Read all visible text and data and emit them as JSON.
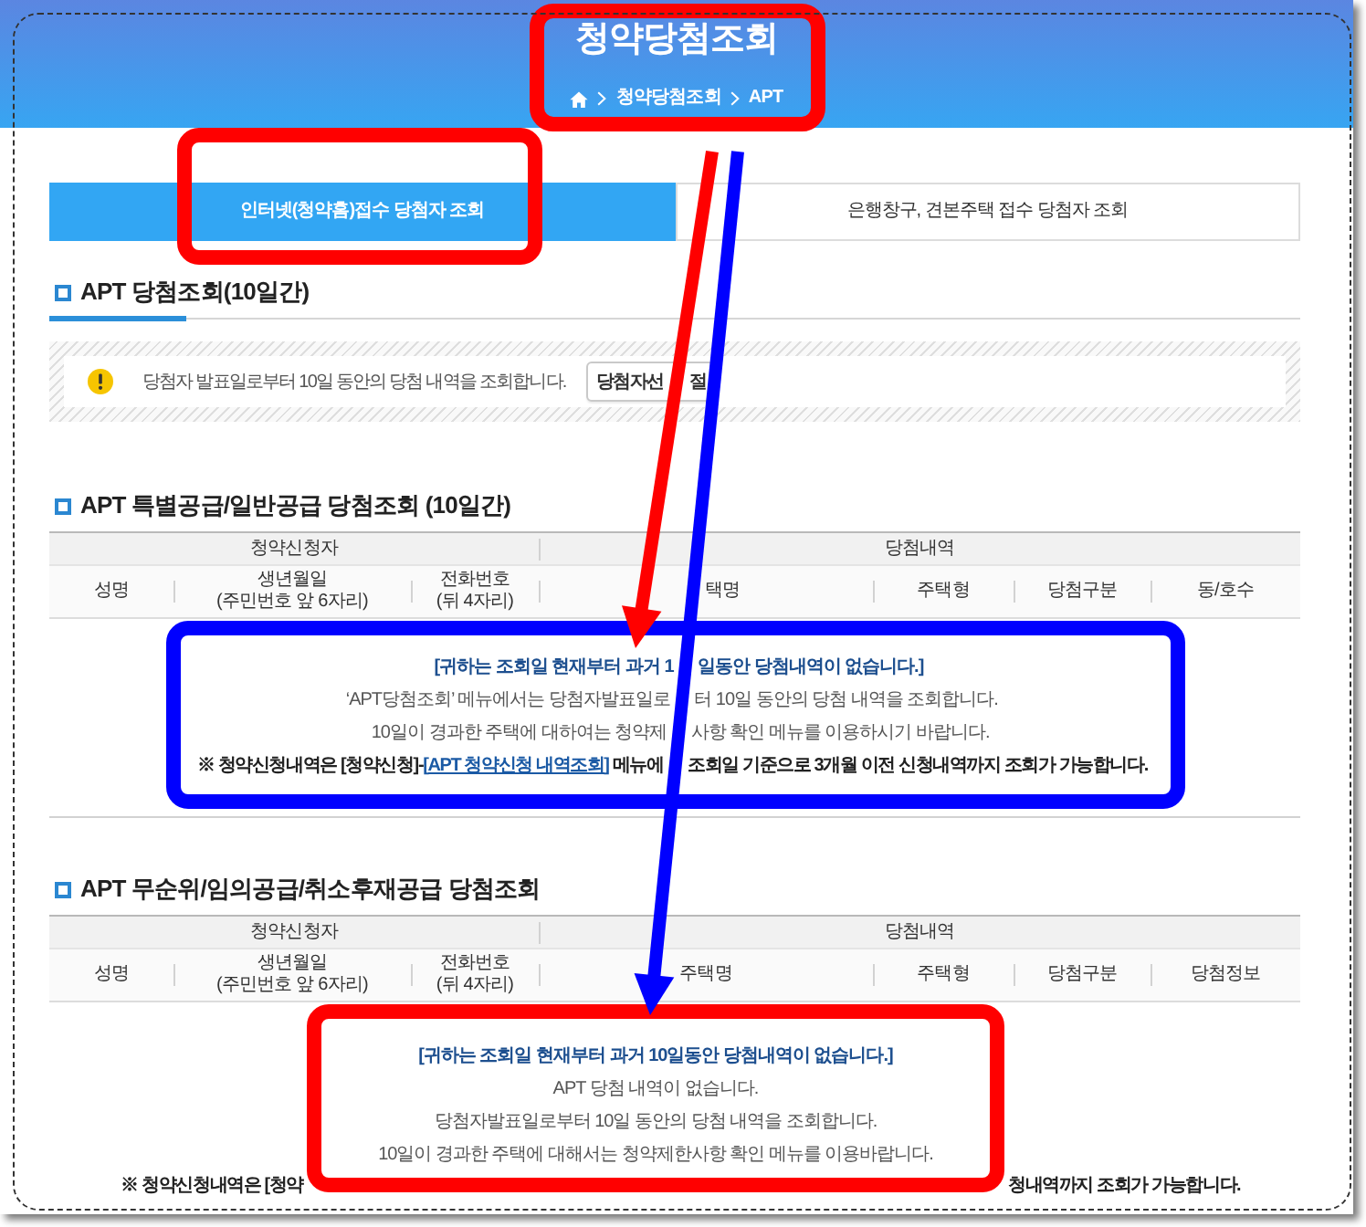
{
  "header": {
    "title": "청약당첨조회",
    "breadcrumb": [
      "청약당첨조회",
      "APT"
    ],
    "highlight": {
      "color": "#ff0000"
    }
  },
  "tabs": [
    {
      "label": "인터넷(청약홈)접수 당첨자 조회",
      "selected": true,
      "highlight": {
        "color": "#ff0000"
      }
    },
    {
      "label": "은행창구, 견본주택 접수 당첨자 조회",
      "selected": false
    }
  ],
  "overview": {
    "title": "APT 당첨조회(10일간)",
    "notice": {
      "text": "당첨자 발표일로부터 10일 동안의 당첨 내역을 조회합니다.",
      "button_parts": [
        "당첨자선",
        "절"
      ]
    }
  },
  "tables": [
    {
      "title": "APT 특별공급/일반공급 당첨조회 (10일간)",
      "groups": [
        {
          "label": "청약신청자",
          "columns": [
            {
              "label": "성명"
            },
            {
              "label": "생년월일",
              "note": "(주민번호 앞 6자리)"
            },
            {
              "label": "전화번호",
              "note": "(뒤 4자리)"
            }
          ]
        },
        {
          "label": "당첨내역",
          "columns": [
            {
              "label": "택명"
            },
            {
              "label": "주택형"
            },
            {
              "label": "당첨구분"
            },
            {
              "label": "동/호수"
            }
          ]
        }
      ],
      "message": {
        "highlight": {
          "color": "#0000ff"
        },
        "lines": [
          {
            "kind": "heading",
            "parts": [
              {
                "text": "[귀하는 조회일 현재부터 과거 1"
              },
              {
                "text": "일동안 당첨내역이 없습니다.]"
              }
            ]
          },
          {
            "kind": "body",
            "parts": [
              {
                "text": "‘APT당첨조회’ 메뉴에서는 당첨자발표일로"
              },
              {
                "text": "터 10일 동안의 당첨 내역을 조회합니다."
              }
            ]
          },
          {
            "kind": "body",
            "parts": [
              {
                "text": "10일이 경과한 주택에 대하여는 청약제"
              },
              {
                "text": "사항 확인 메뉴를 이용하시기 바랍니다."
              }
            ]
          },
          {
            "kind": "note",
            "parts": [
              {
                "text": "※ 청약신청내역은 [청약신청]-",
                "link": "[APT 청약신청 내역조회]",
                "after": " 메뉴에"
              },
              {
                "text": "조회일 기준으로 3개월 이전 신청내역까지 조회가 가능합니다."
              }
            ]
          }
        ]
      }
    },
    {
      "title": "APT 무순위/임의공급/취소후재공급 당첨조회",
      "groups": [
        {
          "label": "청약신청자",
          "columns": [
            {
              "label": "성명"
            },
            {
              "label": "생년월일",
              "note": "(주민번호 앞 6자리)"
            },
            {
              "label": "전화번호",
              "note": "(뒤 4자리)"
            }
          ]
        },
        {
          "label": "당첨내역",
          "columns": [
            {
              "label": "주택명"
            },
            {
              "label": "주택형"
            },
            {
              "label": "당첨구분"
            },
            {
              "label": "당첨정보"
            }
          ]
        }
      ],
      "message": {
        "highlight": {
          "color": "#ff0000"
        },
        "lines": [
          {
            "kind": "heading",
            "parts": [
              {
                "text": "[귀하는 조회일 현재부터 과거 10일동안 당첨내역이 없습니다.]"
              }
            ]
          },
          {
            "kind": "body",
            "parts": [
              {
                "text": "APT 당첨 내역이 없습니다."
              }
            ]
          },
          {
            "kind": "body",
            "parts": [
              {
                "text": "당첨자발표일로부터 10일 동안의 당첨 내역을 조회합니다."
              }
            ]
          },
          {
            "kind": "body",
            "parts": [
              {
                "text": "10일이 경과한 주택에 대해서는 청약제한사항 확인 메뉴를 이용바랍니다."
              }
            ]
          }
        ]
      },
      "footnote": {
        "kind": "note",
        "parts": [
          {
            "text": "※ 청약신청내역은 [청약"
          },
          {
            "text": "청내역까지 조회가 가능합니다."
          }
        ]
      }
    }
  ],
  "arrows": [
    {
      "color": "#ff0000"
    },
    {
      "color": "#0000ff"
    }
  ]
}
